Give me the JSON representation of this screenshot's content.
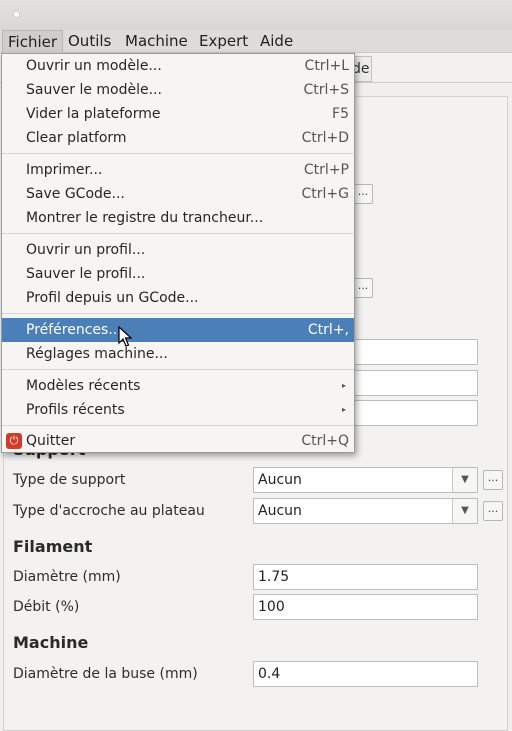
{
  "menubar": {
    "items": [
      "Fichier",
      "Outils",
      "Machine",
      "Expert",
      "Aide"
    ]
  },
  "tab_partial": "de",
  "menu": {
    "items": [
      {
        "label": "Ouvrir un modèle...",
        "shortcut": "Ctrl+L"
      },
      {
        "label": "Sauver le modèle...",
        "shortcut": "Ctrl+S"
      },
      {
        "label": "Vider la plateforme",
        "shortcut": "F5"
      },
      {
        "label": "Clear platform",
        "shortcut": "Ctrl+D"
      },
      {
        "label": "Imprimer...",
        "shortcut": "Ctrl+P"
      },
      {
        "label": "Save GCode...",
        "shortcut": "Ctrl+G"
      },
      {
        "label": "Montrer le registre du trancheur...",
        "shortcut": ""
      },
      {
        "label": "Ouvrir un profil...",
        "shortcut": ""
      },
      {
        "label": "Sauver le profil...",
        "shortcut": ""
      },
      {
        "label": "Profil depuis un GCode...",
        "shortcut": ""
      },
      {
        "label": "Préférences...",
        "shortcut": "Ctrl+,"
      },
      {
        "label": "Réglages machine...",
        "shortcut": ""
      },
      {
        "label": "Modèles récents",
        "shortcut": ""
      },
      {
        "label": "Profils récents",
        "shortcut": ""
      },
      {
        "label": "Quitter",
        "shortcut": "Ctrl+Q"
      }
    ],
    "highlighted": "Préférences...",
    "submenu_arrow": "▸",
    "quit_icon": "power-icon"
  },
  "form": {
    "support_heading_partial": "Support",
    "type_support_label": "Type de support",
    "type_support_value": "Aucun",
    "accroche_label": "Type d'accroche au plateau",
    "accroche_value": "Aucun",
    "filament_heading": "Filament",
    "diametre_label": "Diamètre (mm)",
    "diametre_value": "1.75",
    "debit_label": "Débit (%)",
    "debit_value": "100",
    "machine_heading": "Machine",
    "buse_label": "Diamètre de la buse (mm)",
    "buse_value": "0.4",
    "dots": "...",
    "combo_arrow": "▼"
  },
  "colors": {
    "highlight": "#4a7fb8",
    "quit_icon": "#d23b2a"
  }
}
